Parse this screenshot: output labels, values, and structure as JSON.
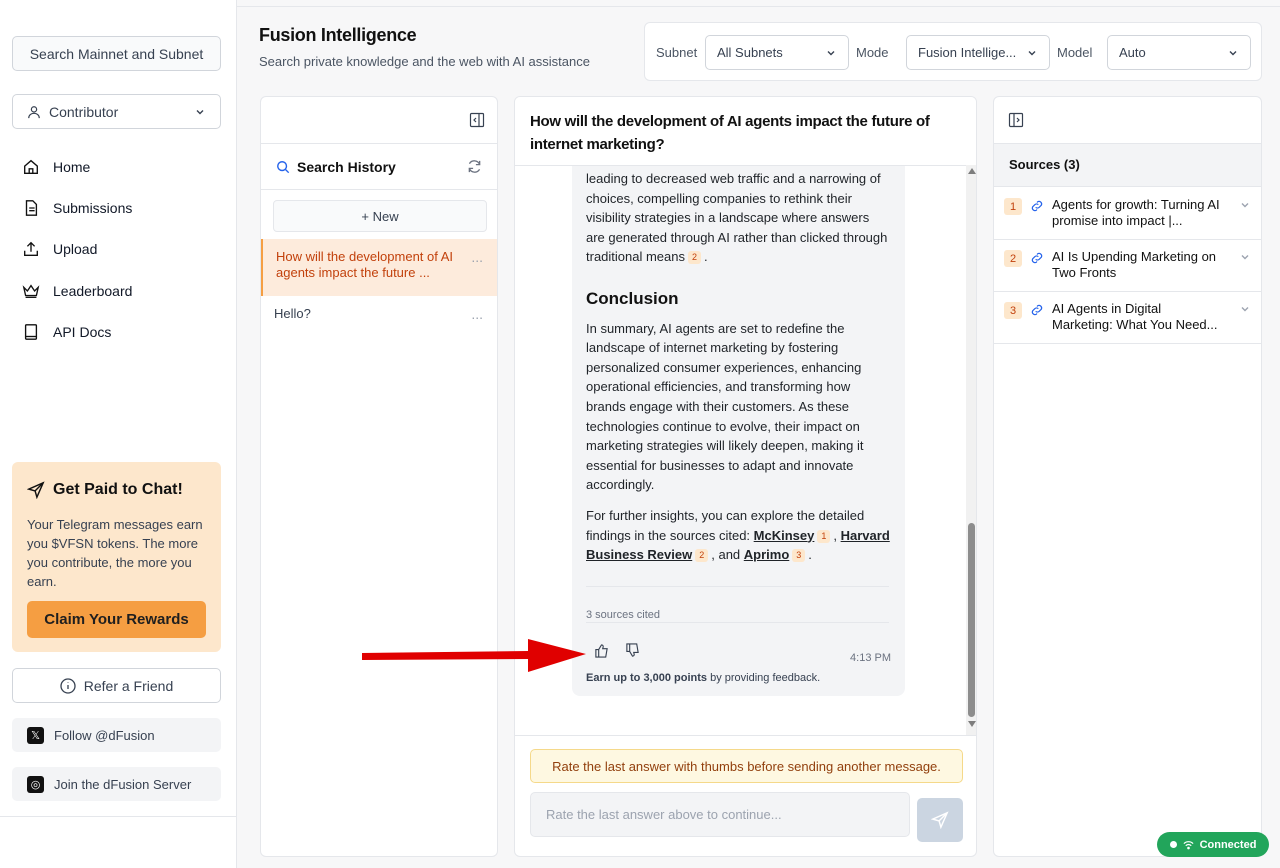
{
  "sidebar": {
    "search_button": "Search Mainnet and Subnet",
    "role": "Contributor",
    "nav": [
      {
        "label": "Home",
        "icon": "home-icon"
      },
      {
        "label": "Submissions",
        "icon": "document-icon"
      },
      {
        "label": "Upload",
        "icon": "upload-icon"
      },
      {
        "label": "Leaderboard",
        "icon": "crown-icon"
      },
      {
        "label": "API Docs",
        "icon": "book-icon"
      }
    ],
    "promo": {
      "title": "Get Paid to Chat!",
      "text": "Your Telegram messages earn you $VFSN tokens. The more you contribute, the more you earn.",
      "button": "Claim Your Rewards"
    },
    "refer": "Refer a Friend",
    "follow": "Follow @dFusion",
    "join": "Join the dFusion Server"
  },
  "header": {
    "title": "Fusion Intelligence",
    "subtitle": "Search private knowledge and the web with AI assistance",
    "subnet_label": "Subnet",
    "subnet_value": "All Subnets",
    "mode_label": "Mode",
    "mode_value": "Fusion Intellige...",
    "model_label": "Model",
    "model_value": "Auto"
  },
  "history": {
    "title": "Search History",
    "new_button": "+ New",
    "items": [
      {
        "label": "How will the development of AI agents impact the future ..."
      },
      {
        "label": "Hello?"
      }
    ],
    "dots": "..."
  },
  "chat": {
    "question": "How will the development of AI agents impact the future of internet marketing?",
    "para1": "leading to decreased web traffic and a narrowing of choices, compelling companies to rethink their visibility strategies in a landscape where answers are generated through AI rather than clicked through traditional means",
    "cite_para1": "2",
    "conclusion_heading": "Conclusion",
    "para2": "In summary, AI agents are set to redefine the landscape of internet marketing by fostering personalized consumer experiences, enhancing operational efficiencies, and transforming how brands engage with their customers. As these technologies continue to evolve, their impact on marketing strategies will likely deepen, making it essential for businesses to adapt and innovate accordingly.",
    "para3_prefix": "For further insights, you can explore the detailed findings in the sources cited:",
    "link1": "McKinsey",
    "link2": "Harvard Business Review",
    "link3": "Aprimo",
    "cite1": "1",
    "cite2": "2",
    "cite3": "3",
    "and_text": ", and",
    "sources_cited": "3 sources cited",
    "time": "4:13 PM",
    "earn_bold": "Earn up to 3,000 points",
    "earn_rest": "by providing feedback.",
    "warning": "Rate the last answer with thumbs before sending another message.",
    "input_placeholder": "Rate the last answer above to continue..."
  },
  "sources": {
    "title": "Sources (3)",
    "items": [
      {
        "num": "1",
        "title": "Agents for growth: Turning AI promise into impact |..."
      },
      {
        "num": "2",
        "title": "AI Is Upending Marketing on Two Fronts"
      },
      {
        "num": "3",
        "title": "AI Agents in Digital Marketing: What You Need..."
      }
    ]
  },
  "status": {
    "connected": "Connected"
  },
  "colors": {
    "accent": "#f59e42",
    "accent_light": "#fde7cc",
    "connected": "#22a55b",
    "arrow": "#e00000"
  }
}
